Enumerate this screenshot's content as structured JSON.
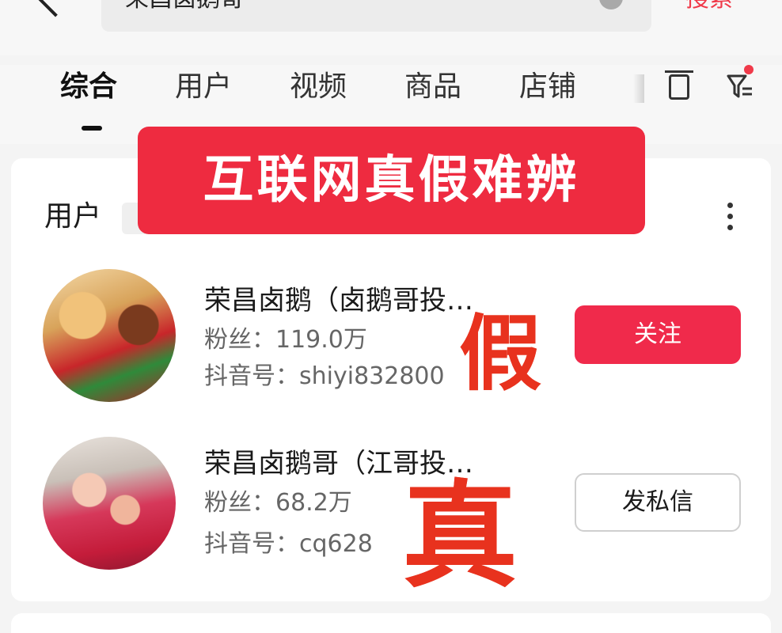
{
  "search": {
    "query": "荣昌卤鹅哥",
    "button_label": "搜索"
  },
  "tabs": [
    {
      "label": "综合",
      "active": true
    },
    {
      "label": "用户",
      "active": false
    },
    {
      "label": "视频",
      "active": false
    },
    {
      "label": "商品",
      "active": false
    },
    {
      "label": "店铺",
      "active": false
    }
  ],
  "overlay_banner": "互联网真假难辨",
  "section": {
    "title": "用户"
  },
  "users": [
    {
      "name": "荣昌卤鹅（卤鹅哥投…",
      "fans": "粉丝：119.0万",
      "douyin_id": "抖音号：shiyi832800",
      "action": "关注",
      "stamp": "假"
    },
    {
      "name": "荣昌卤鹅哥（江哥投…",
      "fans": "粉丝：68.2万",
      "douyin_id": "抖音号：cq628",
      "action": "发私信",
      "stamp": "真"
    }
  ],
  "colors": {
    "accent": "#f02a4b",
    "stamp": "#e8321e",
    "banner": "#ee2b40"
  },
  "icons": [
    "back-icon",
    "clear-icon",
    "layout-icon",
    "filter-icon",
    "more-icon"
  ]
}
